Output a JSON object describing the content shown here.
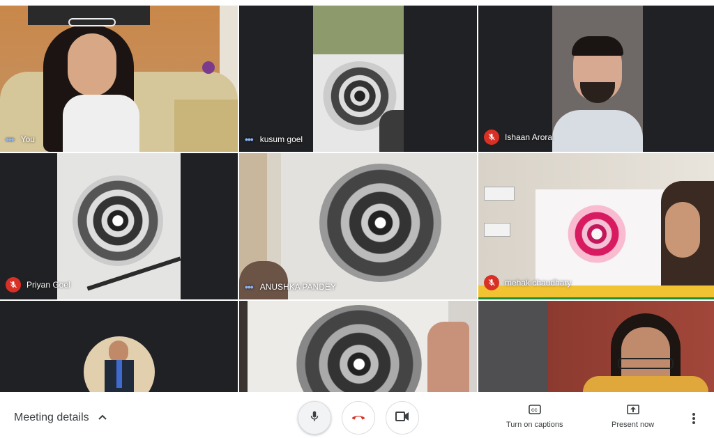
{
  "participants": [
    {
      "name": "You",
      "status": "speaking"
    },
    {
      "name": "kusum goel",
      "status": "speaking"
    },
    {
      "name": "Ishaan Arora",
      "status": "muted"
    },
    {
      "name": "Priyan Goel",
      "status": "muted"
    },
    {
      "name": "ANUSHKA PANDEY",
      "status": "speaking"
    },
    {
      "name": "mehak chaudhary",
      "status": "muted"
    }
  ],
  "controls": {
    "meeting_details": "Meeting details",
    "captions": "Turn on captions",
    "present": "Present now"
  },
  "icons": [
    "chevron-up-icon",
    "microphone-icon",
    "hang-up-icon",
    "camera-icon",
    "captions-icon",
    "present-icon",
    "more-vert-icon",
    "mic-off-icon"
  ],
  "colors": {
    "tile_bg": "#202124",
    "mute_red": "#d93025",
    "active_blue": "#8ab4f8",
    "hangup_red": "#d93025"
  }
}
